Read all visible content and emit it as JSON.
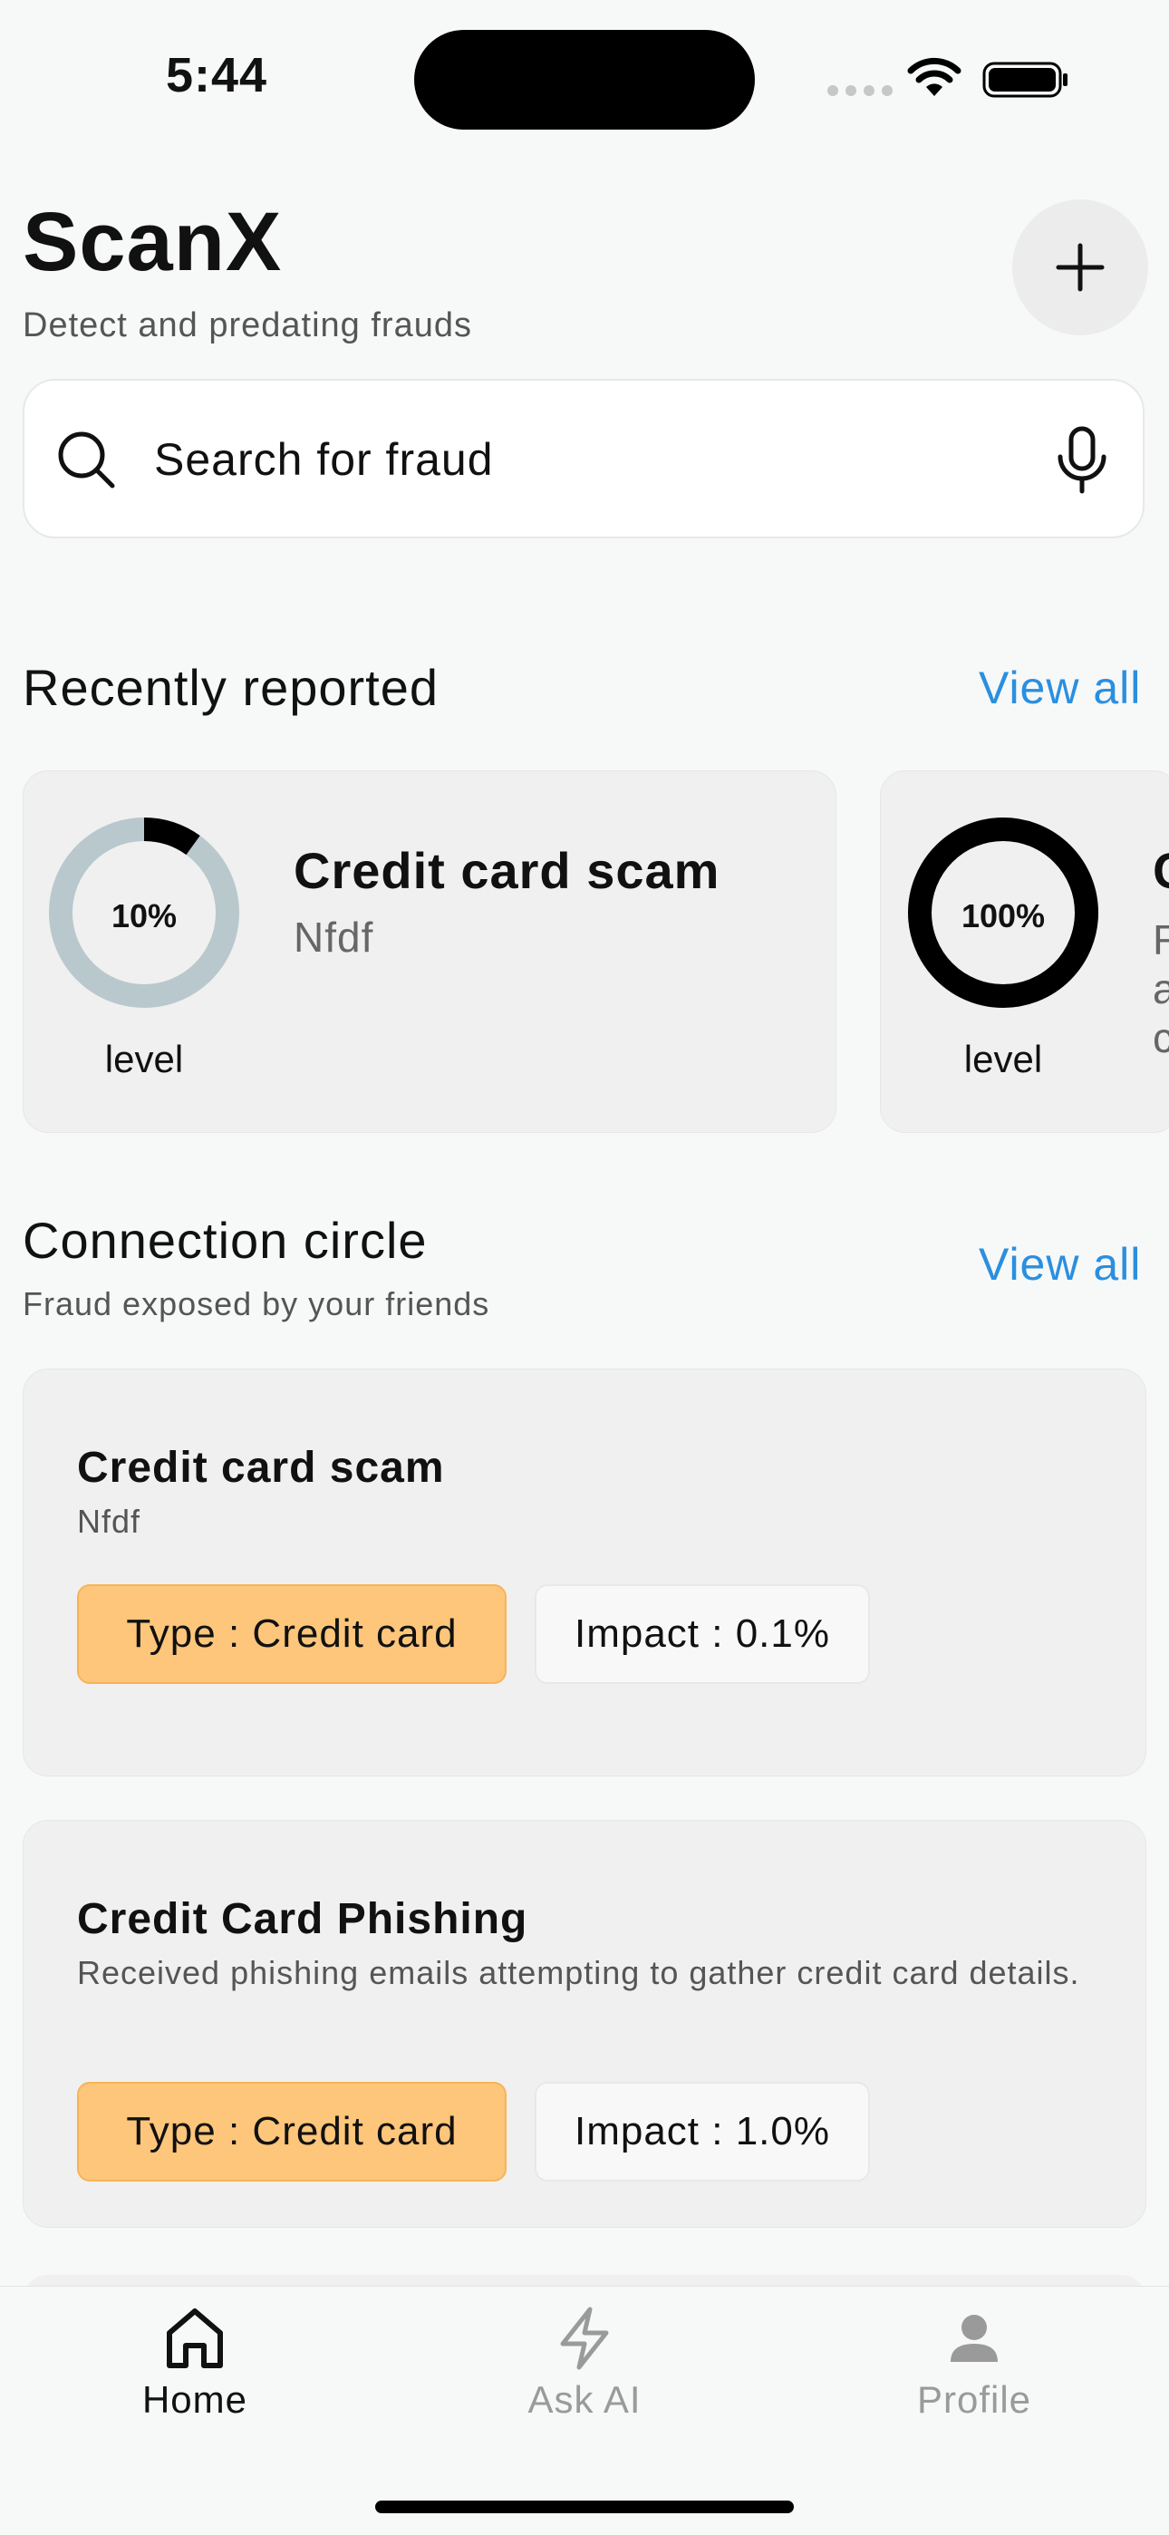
{
  "status_bar": {
    "time": "5:44"
  },
  "header": {
    "title": "ScanX",
    "subtitle": "Detect and predating frauds"
  },
  "search": {
    "placeholder": "Search for fraud"
  },
  "recently_reported": {
    "heading": "Recently reported",
    "view_all": "View all",
    "cards": [
      {
        "percent_label": "10%",
        "level_fraction": 0.1,
        "level_label": "level",
        "title": "Credit card scam",
        "subtitle": "Nfdf"
      },
      {
        "percent_label": "100%",
        "level_fraction": 1.0,
        "level_label": "level",
        "title": "C",
        "subtitle_lines": [
          "R",
          "a",
          "c"
        ]
      }
    ]
  },
  "connection_circle": {
    "heading": "Connection circle",
    "subheading": "Fraud exposed by your friends",
    "view_all": "View all",
    "items": [
      {
        "title": "Credit card scam",
        "description": "Nfdf",
        "type": "Type : Credit card",
        "impact": "Impact : 0.1%"
      },
      {
        "title": "Credit Card Phishing",
        "description": "Received phishing emails attempting to gather credit card details.",
        "type": "Type : Credit card",
        "impact": "Impact : 1.0%"
      }
    ]
  },
  "tab_bar": {
    "tabs": [
      {
        "label": "Home",
        "icon": "home-icon",
        "active": true
      },
      {
        "label": "Ask AI",
        "icon": "lightning-icon",
        "active": false
      },
      {
        "label": "Profile",
        "icon": "person-icon",
        "active": false
      }
    ]
  },
  "colors": {
    "accent": "#2a8fe0",
    "type_chip": "#fdc67a",
    "ring_track": "#b9c8cc",
    "ring_fill": "#000000",
    "inactive_tab": "#9a9a9a"
  }
}
